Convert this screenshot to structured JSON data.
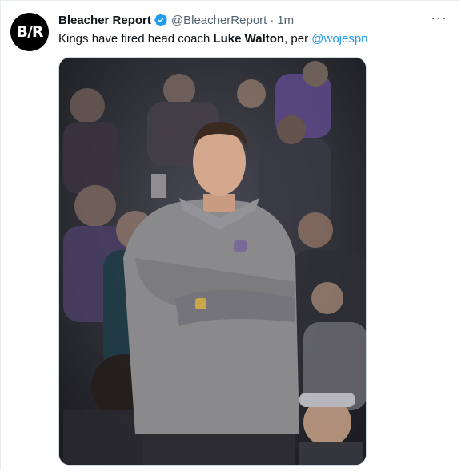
{
  "tweet": {
    "author_name": "Bleacher Report",
    "avatar_text": "B/R",
    "handle": "@BleacherReport",
    "separator": "·",
    "time": "1m",
    "more_label": "···",
    "text_before": "Kings have fired head coach ",
    "text_bold": "Luke Walton",
    "text_after": ", per ",
    "mention": "@wojespn",
    "verified_icon": "verified-badge-icon",
    "colors": {
      "accent": "#1d9bf0",
      "secondary_text": "#536471",
      "primary_text": "#0f1419"
    }
  }
}
